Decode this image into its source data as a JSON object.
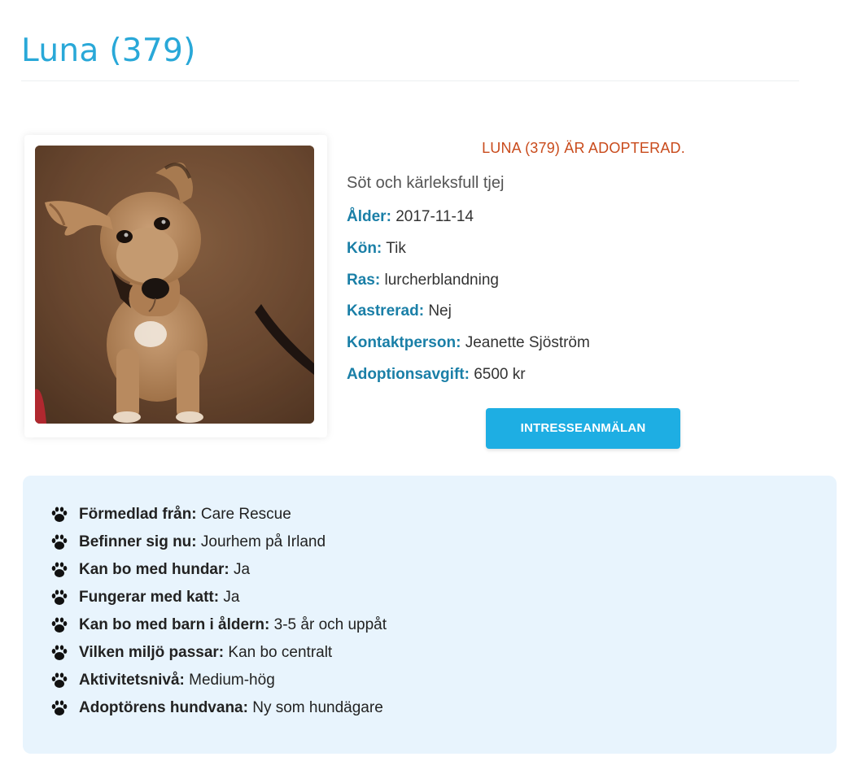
{
  "page": {
    "title": "Luna (379)"
  },
  "photo": {
    "subject": "Brown puppy sitting on carpet"
  },
  "status": "LUNA (379) ÄR ADOPTERAD.",
  "tagline": "Söt och kärleksfull tjej",
  "facts": [
    {
      "label": "Ålder:",
      "value": "2017-11-14"
    },
    {
      "label": "Kön:",
      "value": "Tik"
    },
    {
      "label": "Ras:",
      "value": "lurcherblandning"
    },
    {
      "label": "Kastrerad:",
      "value": "Nej"
    },
    {
      "label": "Kontaktperson:",
      "value": "Jeanette Sjöström"
    },
    {
      "label": "Adoptionsavgift:",
      "value": "6500 kr"
    }
  ],
  "interest_button": "INTRESSEANMÄLAN",
  "details": [
    {
      "label": "Förmedlad från:",
      "value": "Care Rescue",
      "icon": "paw-icon"
    },
    {
      "label": "Befinner sig nu:",
      "value": "Jourhem på Irland",
      "icon": "paw-icon"
    },
    {
      "label": "Kan bo med hundar:",
      "value": "Ja",
      "icon": "paw-icon"
    },
    {
      "label": "Fungerar med katt:",
      "value": "Ja",
      "icon": "paw-icon"
    },
    {
      "label": "Kan bo med barn i åldern:",
      "value": "3-5 år och uppåt",
      "icon": "paw-icon"
    },
    {
      "label": "Vilken miljö passar:",
      "value": "Kan bo centralt",
      "icon": "paw-icon"
    },
    {
      "label": "Aktivitetsnivå:",
      "value": "Medium-hög",
      "icon": "paw-icon"
    },
    {
      "label": "Adoptörens hundvana:",
      "value": "Ny som hundägare",
      "icon": "paw-icon"
    }
  ],
  "colors": {
    "title": "#29a8d8",
    "status": "#c94b1c",
    "label": "#1a7fa7",
    "button": "#1eaee3",
    "panel": "#e8f4fd"
  }
}
